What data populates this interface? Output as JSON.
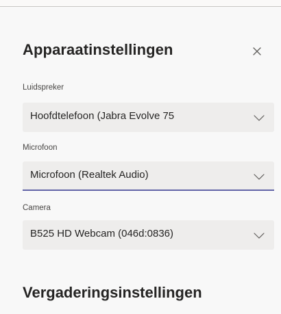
{
  "dialog": {
    "title": "Apparaatinstellingen",
    "close_icon": "close-icon"
  },
  "speaker": {
    "label": "Luidspreker",
    "value": "Hoofdtelefoon (Jabra Evolve 75"
  },
  "microphone": {
    "label": "Microfoon",
    "value": "Microfoon (Realtek Audio)"
  },
  "camera": {
    "label": "Camera",
    "value": "B525 HD Webcam (046d:0836)"
  },
  "meeting": {
    "title": "Vergaderingsinstellingen"
  },
  "colors": {
    "accent": "#6264a7",
    "field_background": "#eeedec",
    "panel_background": "#f8f8f8"
  }
}
